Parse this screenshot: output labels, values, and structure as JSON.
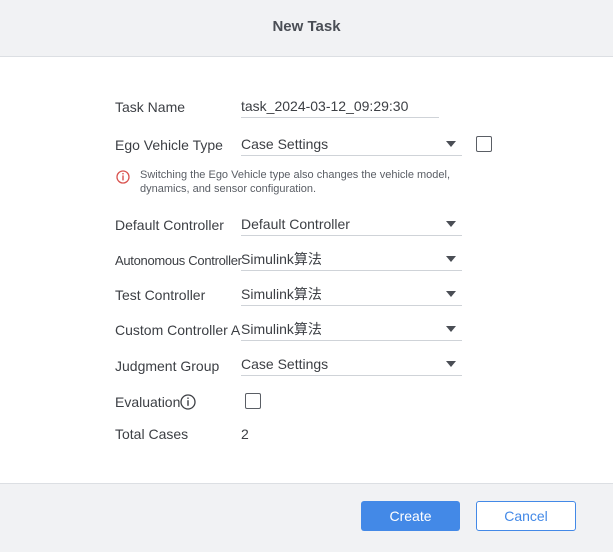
{
  "dialog": {
    "title": "New Task"
  },
  "form": {
    "task_name": {
      "label": "Task Name",
      "value": "task_2024-03-12_09:29:30"
    },
    "ego_vehicle_type": {
      "label": "Ego Vehicle Type",
      "value": "Case Settings",
      "checked": false,
      "hint": "Switching the Ego Vehicle type also changes the vehicle model, dynamics, and sensor configuration.",
      "hint_icon": "info-circle-icon",
      "hint_icon_color": "#d9534f"
    },
    "default_controller": {
      "label": "Default Controller",
      "value": "Default Controller"
    },
    "autonomous_controller": {
      "label": "Autonomous Controller",
      "value": "Simulink算法"
    },
    "test_controller": {
      "label": "Test Controller",
      "value": "Simulink算法"
    },
    "custom_controller_a": {
      "label": "Custom Controller A",
      "value": "Simulink算法"
    },
    "judgment_group": {
      "label": "Judgment Group",
      "value": "Case Settings"
    },
    "evaluation": {
      "label": "Evaluation",
      "checked": false,
      "info_icon": "info-circle-icon"
    },
    "total_cases": {
      "label": "Total Cases",
      "value": "2"
    }
  },
  "footer": {
    "create_label": "Create",
    "cancel_label": "Cancel"
  },
  "colors": {
    "accent": "#4389e7",
    "header_bg": "#f1f2f4"
  }
}
